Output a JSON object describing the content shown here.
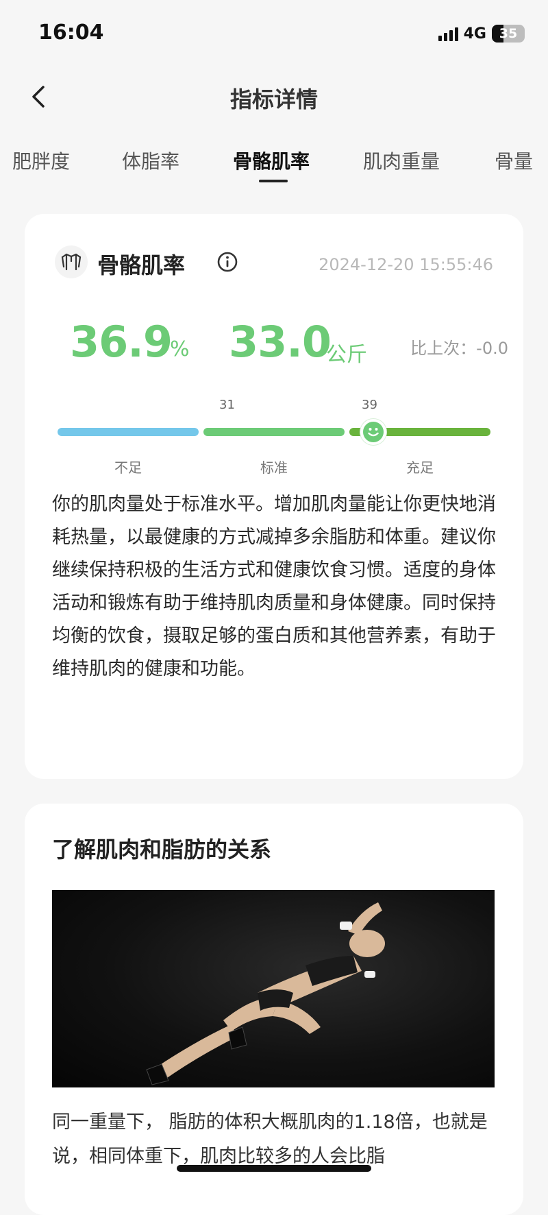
{
  "status_bar": {
    "time": "16:04",
    "network": "4G",
    "battery": "35",
    "battery_level": 0.35
  },
  "nav": {
    "title": "指标详情"
  },
  "tabs": [
    {
      "label": "肥胖度",
      "active": false
    },
    {
      "label": "体脂率",
      "active": false
    },
    {
      "label": "骨骼肌率",
      "active": true
    },
    {
      "label": "肌肉重量",
      "active": false
    },
    {
      "label": "骨量",
      "active": false
    }
  ],
  "metric": {
    "title": "骨骼肌率",
    "timestamp": "2024-12-20 15:55:46",
    "percent_value": "36.9",
    "percent_unit": "%",
    "weight_value": "33.0",
    "weight_unit": "公斤",
    "compare": "比上次：-0.0",
    "value_color": "#6ccb76"
  },
  "scale": {
    "thresholds": [
      "31",
      "39"
    ],
    "segments": [
      {
        "label": "不足",
        "color": "#74c7ea"
      },
      {
        "label": "标准",
        "color": "#6ccb76"
      },
      {
        "label": "充足",
        "color": "#69b33c"
      }
    ],
    "marker_fraction": 0.73
  },
  "description": "你的肌肉量处于标准水平。增加肌肉量能让你更快地消耗热量，以最健康的方式减掉多余脂肪和体重。建议你继续保持积极的生活方式和健康饮食习惯。适度的身体活动和锻炼有助于维持肌肉质量和身体健康。同时保持均衡的饮食，摄取足够的蛋白质和其他营养素，有助于维持肌肉的健康和功能。",
  "article": {
    "title": "了解肌肉和脂肪的关系",
    "text": "同一重量下， 脂肪的体积大概肌肉的1.18倍，也就是说，相同体重下，肌肉比较多的人会比脂"
  }
}
